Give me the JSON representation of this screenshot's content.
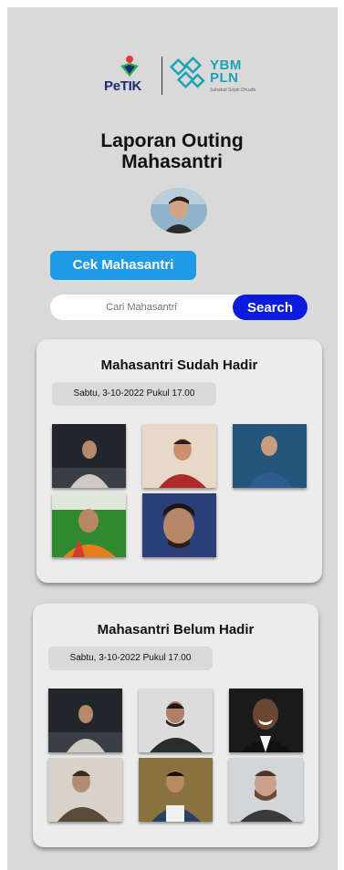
{
  "logos": {
    "petik_text": "PeTIK",
    "ybm_text_line1": "YBM",
    "ybm_text_line2": "PLN",
    "ybm_sub": "Sahabat Sejati Dhuafa"
  },
  "header": {
    "title_line1": "Laporan Outing",
    "title_line2": "Mahasantri"
  },
  "actions": {
    "cek_label": "Cek Mahasantri"
  },
  "search": {
    "placeholder": "Cari Mahasantri",
    "button_label": "Search"
  },
  "present": {
    "title": "Mahasantri Sudah Hadir",
    "date": "Sabtu, 3-10-2022 Pukul 17.00"
  },
  "absent": {
    "title": "Mahasantri Belum Hadir",
    "date": "Sabtu, 3-10-2022 Pukul 17.00"
  },
  "colors": {
    "background": "#d9d9d9",
    "card": "#ececec",
    "cek_button": "#1e9ae6",
    "search_button": "#0a1bdc"
  }
}
